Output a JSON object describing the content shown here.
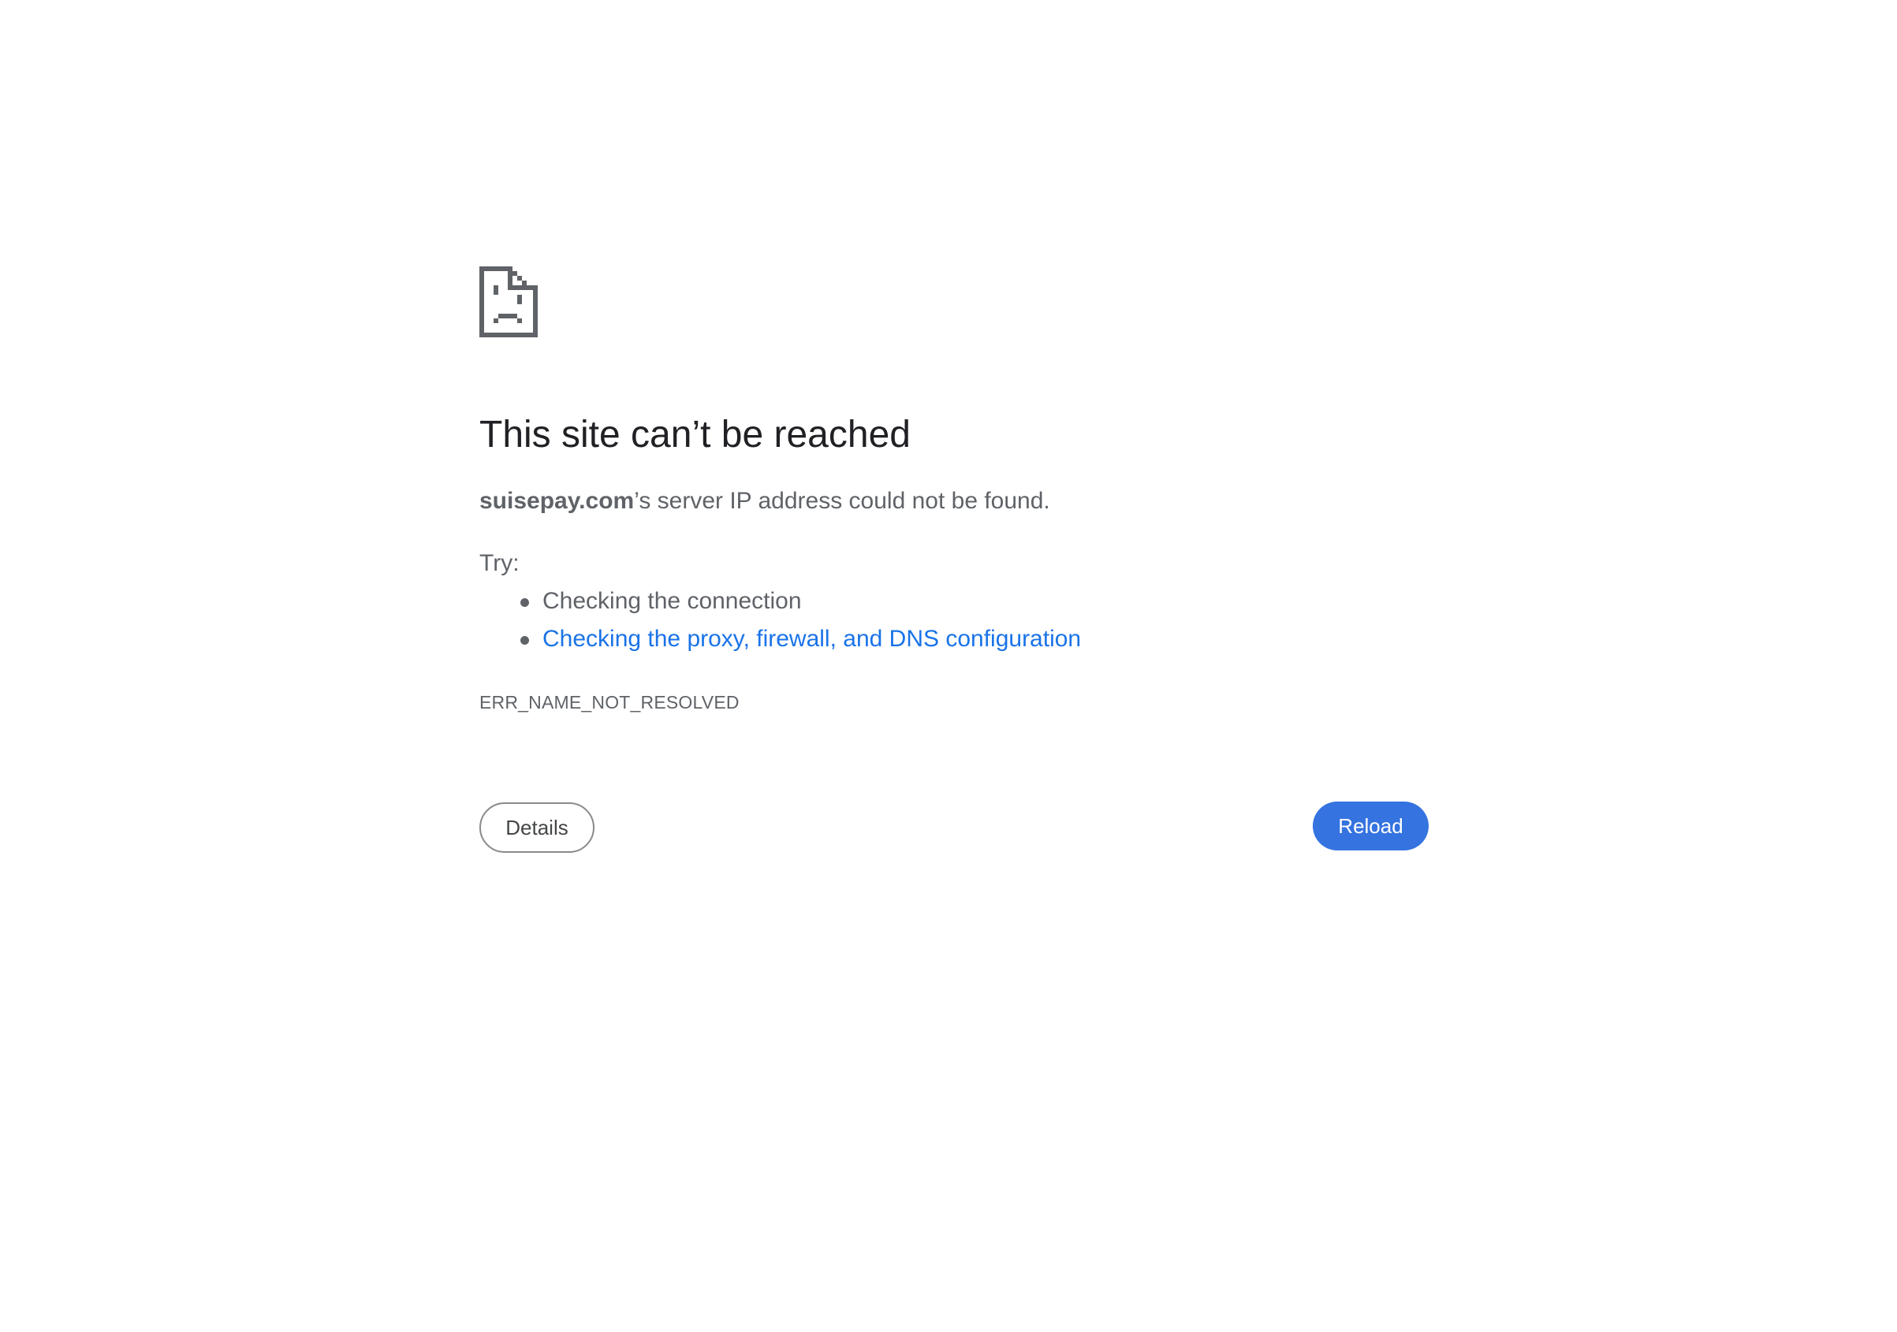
{
  "page": {
    "icon": "sad-page-icon",
    "title": "This site can’t be reached",
    "message": {
      "host": "suisepay.com",
      "suffix": "’s server IP address could not be found."
    },
    "try_label": "Try:",
    "suggestions": [
      {
        "label": "Checking the connection",
        "is_link": false
      },
      {
        "label": "Checking the proxy, firewall, and DNS configuration",
        "is_link": true
      }
    ],
    "error_code": "ERR_NAME_NOT_RESOLVED",
    "buttons": {
      "details_label": "Details",
      "reload_label": "Reload"
    }
  },
  "colors": {
    "title": "#202124",
    "text": "#5f6368",
    "link": "#1a73e8",
    "primary_button": "#3473e0",
    "background": "#ffffff"
  }
}
